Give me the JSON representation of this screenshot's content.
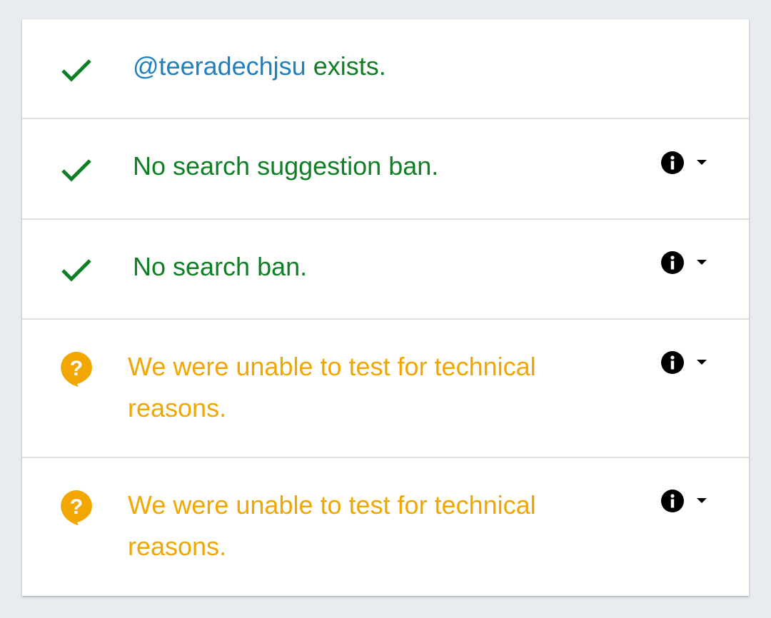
{
  "results": [
    {
      "status": "pass",
      "icon": "checkmark-icon",
      "handle": "@teeradechjsu",
      "text": " exists.",
      "has_details": false
    },
    {
      "status": "pass",
      "icon": "checkmark-icon",
      "text": "No search suggestion ban.",
      "has_details": true
    },
    {
      "status": "pass",
      "icon": "checkmark-icon",
      "text": "No search ban.",
      "has_details": true
    },
    {
      "status": "unknown",
      "icon": "question-bubble-icon",
      "text": "We were unable to test for technical reasons.",
      "has_details": true
    },
    {
      "status": "unknown",
      "icon": "question-bubble-icon",
      "text": "We were unable to test for technical reasons.",
      "has_details": true
    }
  ],
  "colors": {
    "pass": "#0f7f25",
    "unknown": "#f2a600",
    "handle": "#1f80c0",
    "background": "#e8ecf0",
    "card": "#ffffff"
  }
}
